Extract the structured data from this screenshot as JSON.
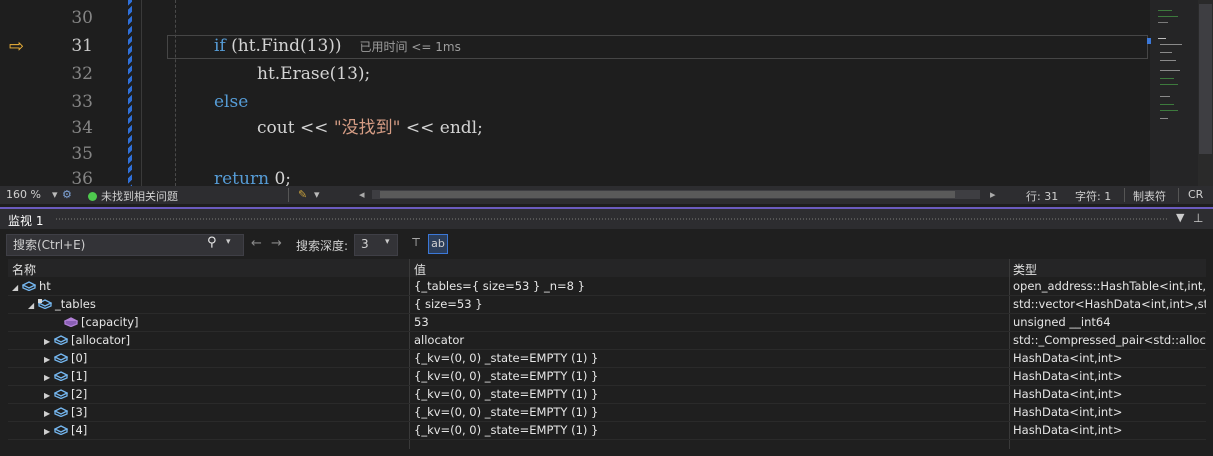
{
  "editor": {
    "lines": [
      {
        "num": "30"
      },
      {
        "num": "31"
      },
      {
        "num": "32"
      },
      {
        "num": "33"
      },
      {
        "num": "34"
      },
      {
        "num": "35"
      },
      {
        "num": "36"
      }
    ],
    "code": {
      "l31_kw": "if",
      "l31_rest": " (ht.Find(13))",
      "l31_hint": "已用时间 <= 1ms",
      "l32": "ht.Erase(13);",
      "l33_kw": "else",
      "l34_a": "cout << ",
      "l34_str": "\"没找到\"",
      "l34_b": " << endl;",
      "l36_kw": "return",
      "l36_rest": " 0;"
    },
    "current_line_icon": "yellow-arrow-icon",
    "colors": {
      "keyword": "#569cd6",
      "string": "#d69d85",
      "background": "#1e1e1e"
    }
  },
  "status_strip": {
    "zoom": "160 %",
    "issues": "未找到相关问题",
    "line": "行: 31",
    "char": "字符: 1",
    "tabs": "制表符",
    "crlf": "CR"
  },
  "watch": {
    "title": "监视 1",
    "search_placeholder": "搜索(Ctrl+E)",
    "search_depth_label": "搜索深度:",
    "search_depth_value": "3",
    "columns": {
      "name": "名称",
      "value": "值",
      "type": "类型"
    },
    "rows": [
      {
        "expander": "expanded",
        "icon": "blue-cube-icon",
        "name": "ht",
        "value": "{_tables={ size=53 } _n=8 }",
        "type": "open_address::HashTable<int,int,..."
      },
      {
        "expander": "expanded",
        "icon": "private-field-icon",
        "name": "_tables",
        "value": "{ size=53 }",
        "type": "std::vector<HashData<int,int>,std..."
      },
      {
        "expander": "none",
        "icon": "purple-cube-icon",
        "name": "[capacity]",
        "value": "53",
        "type": "unsigned __int64"
      },
      {
        "expander": "collapsed",
        "icon": "blue-cube-icon",
        "name": "[allocator]",
        "value": "allocator",
        "type": "std::_Compressed_pair<std::alloca..."
      },
      {
        "expander": "collapsed",
        "icon": "blue-cube-icon",
        "name": "[0]",
        "value": "{_kv=(0, 0) _state=EMPTY (1) }",
        "type": "HashData<int,int>"
      },
      {
        "expander": "collapsed",
        "icon": "blue-cube-icon",
        "name": "[1]",
        "value": "{_kv=(0, 0) _state=EMPTY (1) }",
        "type": "HashData<int,int>"
      },
      {
        "expander": "collapsed",
        "icon": "blue-cube-icon",
        "name": "[2]",
        "value": "{_kv=(0, 0) _state=EMPTY (1) }",
        "type": "HashData<int,int>"
      },
      {
        "expander": "collapsed",
        "icon": "blue-cube-icon",
        "name": "[3]",
        "value": "{_kv=(0, 0) _state=EMPTY (1) }",
        "type": "HashData<int,int>"
      },
      {
        "expander": "collapsed",
        "icon": "blue-cube-icon",
        "name": "[4]",
        "value": "{_kv=(0, 0) _state=EMPTY (1) }",
        "type": "HashData<int,int>"
      }
    ]
  },
  "colors": {
    "accent": "#3b78d8",
    "panel_separator": "#6b5bbf",
    "ok_green": "#4ec94e",
    "arrow_yellow": "#f2b53a"
  }
}
